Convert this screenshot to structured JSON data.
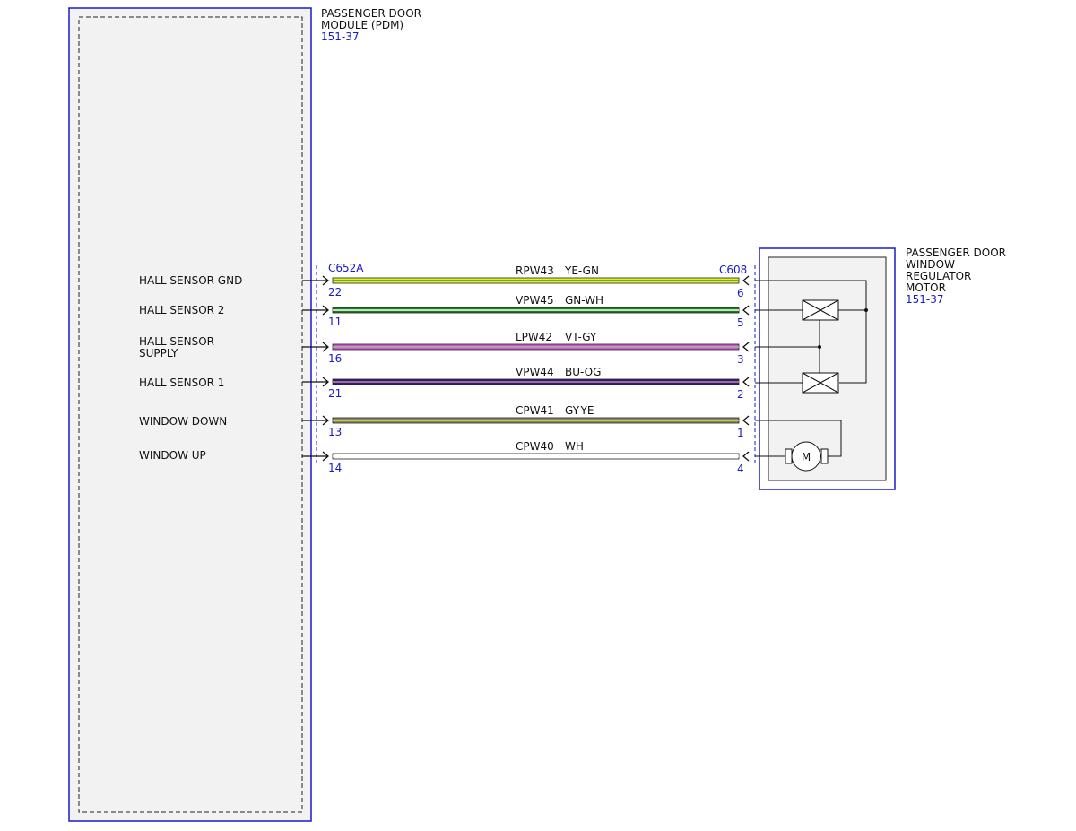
{
  "colors": {
    "component_border": "#1a1acc",
    "component_fill": "#f2f2f2",
    "ref_text": "#1a1acc"
  },
  "module": {
    "title_line1": "PASSENGER DOOR",
    "title_line2": "MODULE (PDM)",
    "ref": "151-37"
  },
  "motor_component": {
    "title_line1": "PASSENGER DOOR",
    "title_line2": "WINDOW",
    "title_line3": "REGULATOR",
    "title_line4": "MOTOR",
    "ref": "151-37",
    "motor_symbol": "M"
  },
  "connectors": {
    "left": "C652A",
    "right": "C608"
  },
  "circuits": [
    {
      "signal_line1": "HALL SENSOR GND",
      "signal_line2": "",
      "pin_left": "22",
      "pin_right": "6",
      "circuit": "RPW43",
      "wire_color": "YE-GN",
      "color_main": "#e6ee2c",
      "color_stripe": "#3a9a2a"
    },
    {
      "signal_line1": "HALL SENSOR 2",
      "signal_line2": "",
      "pin_left": "11",
      "pin_right": "5",
      "circuit": "VPW45",
      "wire_color": "GN-WH",
      "color_main": "#1e7a1e",
      "color_stripe": "#ffffff"
    },
    {
      "signal_line1": "HALL SENSOR",
      "signal_line2": "SUPPLY",
      "pin_left": "16",
      "pin_right": "3",
      "circuit": "LPW42",
      "wire_color": "VT-GY",
      "color_main": "#c85ac8",
      "color_stripe": "#b0b0b0"
    },
    {
      "signal_line1": "HALL SENSOR 1",
      "signal_line2": "",
      "pin_left": "21",
      "pin_right": "2",
      "circuit": "VPW44",
      "wire_color": "BU-OG",
      "color_main": "#1a1ab8",
      "color_stripe": "#f08a1c"
    },
    {
      "signal_line1": "WINDOW DOWN",
      "signal_line2": "",
      "pin_left": "13",
      "pin_right": "1",
      "circuit": "CPW41",
      "wire_color": "GY-YE",
      "color_main": "#8a8a6a",
      "color_stripe": "#d8d830"
    },
    {
      "signal_line1": "WINDOW UP",
      "signal_line2": "",
      "pin_left": "14",
      "pin_right": "4",
      "circuit": "CPW40",
      "wire_color": "WH",
      "color_main": "#ffffff",
      "color_stripe": "#ffffff"
    }
  ]
}
